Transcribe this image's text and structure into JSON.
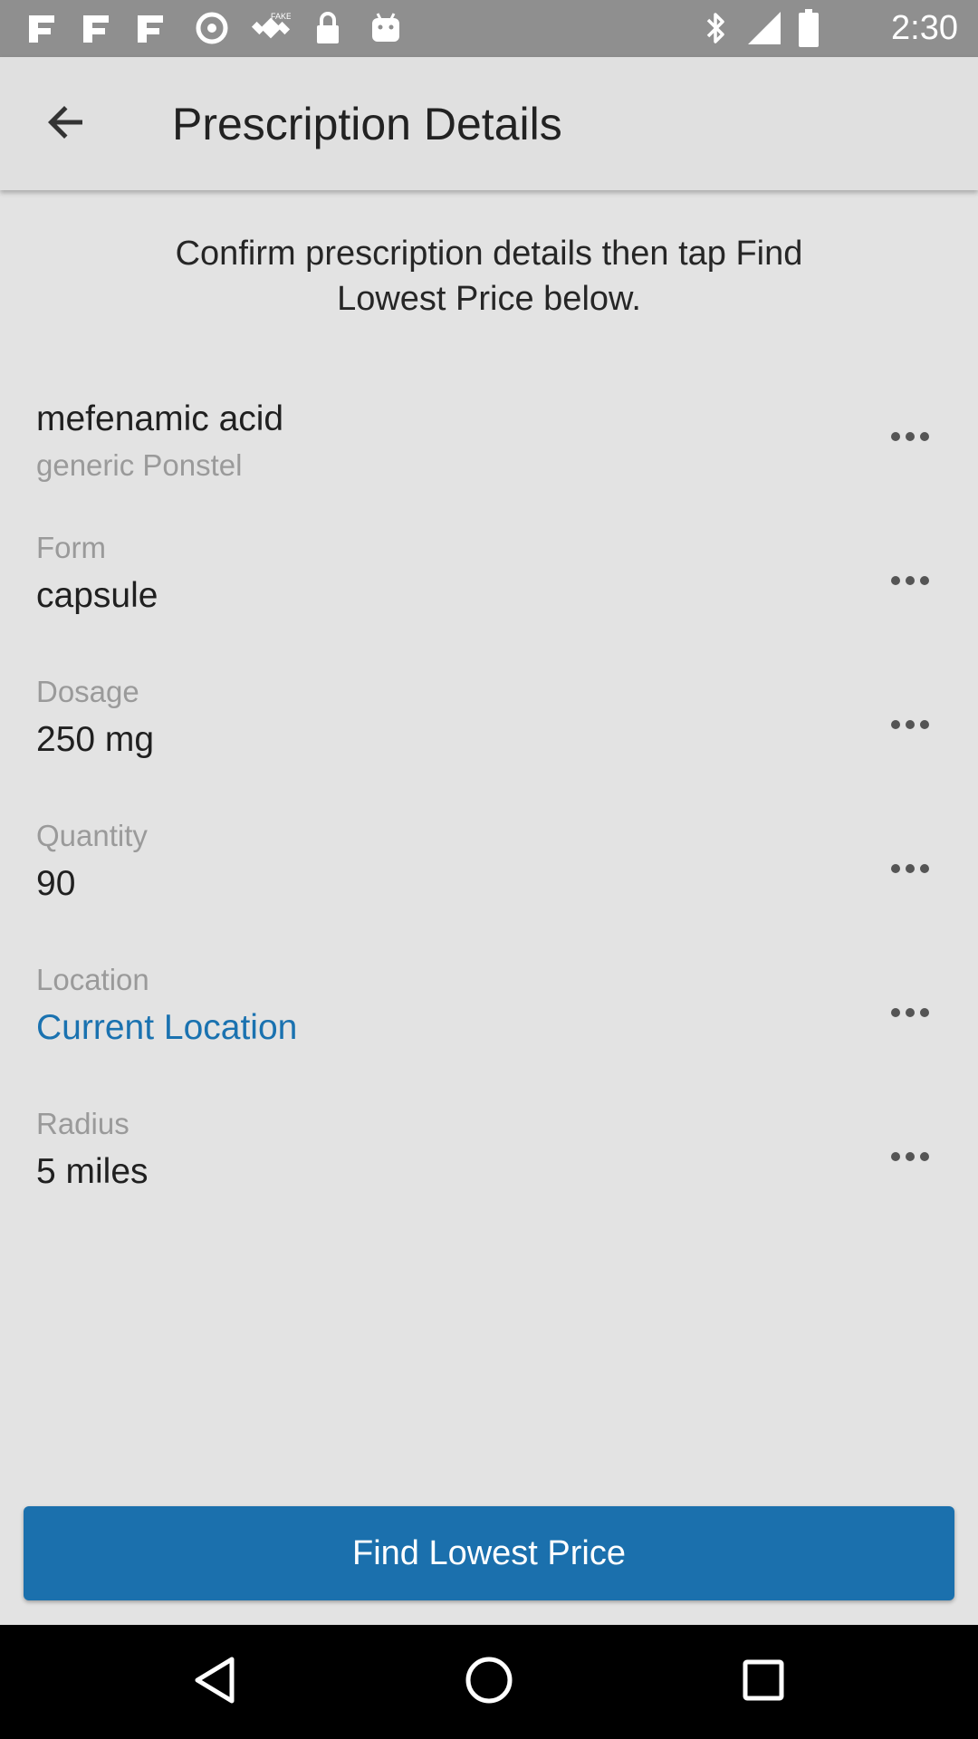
{
  "status_bar": {
    "time": "2:30",
    "icons": [
      "notification-icon",
      "notification-icon",
      "notification-icon",
      "vpn-icon",
      "fake-gps-icon",
      "lock-icon",
      "android-icon",
      "bluetooth-icon",
      "signal-icon",
      "battery-icon"
    ]
  },
  "app_bar": {
    "title": "Prescription Details",
    "back_icon": "arrow-back-icon"
  },
  "instructions": "Confirm prescription details then tap Find Lowest Price below.",
  "drug": {
    "name": "mefenamic acid",
    "subtitle": "generic Ponstel"
  },
  "fields": {
    "form": {
      "label": "Form",
      "value": "capsule"
    },
    "dosage": {
      "label": "Dosage",
      "value": "250 mg"
    },
    "quantity": {
      "label": "Quantity",
      "value": "90"
    },
    "location": {
      "label": "Location",
      "value": "Current Location"
    },
    "radius": {
      "label": "Radius",
      "value": "5 miles"
    }
  },
  "more_icon": "more-horizontal-icon",
  "find_button": {
    "label": "Find Lowest Price"
  },
  "colors": {
    "accent": "#1b70ad",
    "link": "#1a72b0",
    "background": "#e3e3e3",
    "status_bar": "#8f8f8f"
  },
  "nav_bar": {
    "icons": [
      "back-triangle-icon",
      "home-circle-icon",
      "recents-square-icon"
    ]
  }
}
